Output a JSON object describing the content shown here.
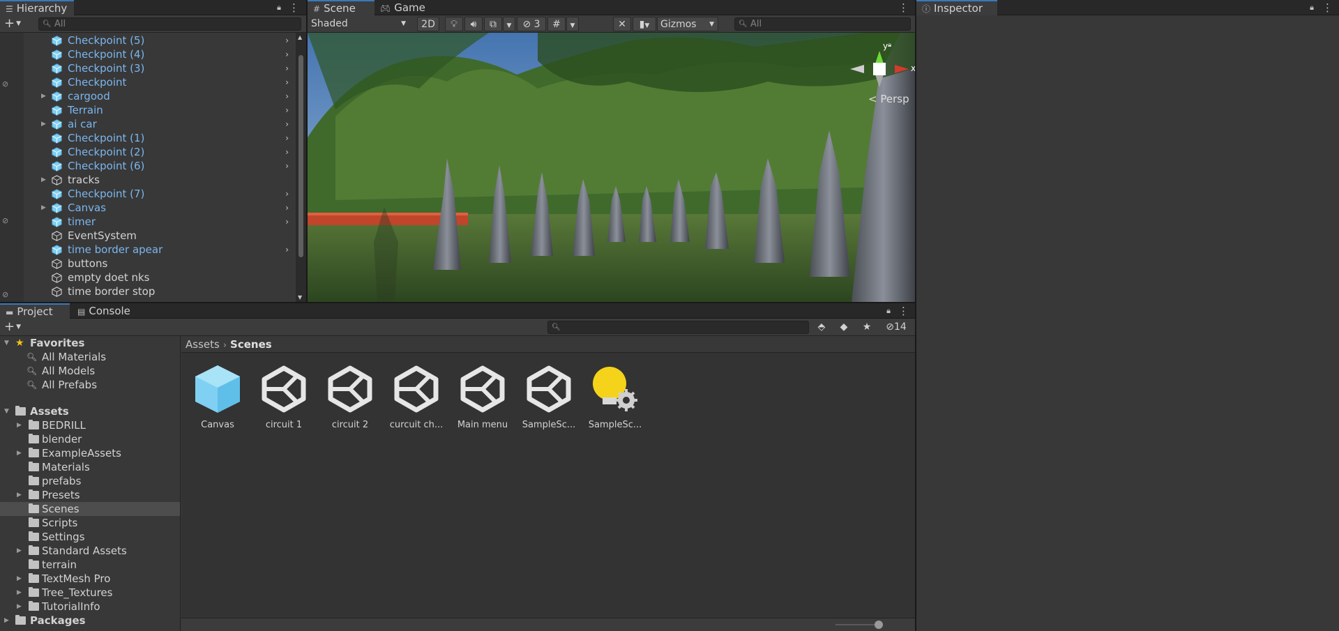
{
  "hierarchy": {
    "tab_label": "Hierarchy",
    "search_placeholder": "All",
    "items": [
      {
        "label": "Checkpoint (5)",
        "kind": "prefab",
        "expandable": false,
        "has_arrow": true
      },
      {
        "label": "Checkpoint (4)",
        "kind": "prefab",
        "expandable": false,
        "has_arrow": true
      },
      {
        "label": "Checkpoint (3)",
        "kind": "prefab",
        "expandable": false,
        "has_arrow": true
      },
      {
        "label": "Checkpoint",
        "kind": "prefab",
        "expandable": false,
        "has_arrow": true
      },
      {
        "label": "cargood",
        "kind": "prefab",
        "expandable": true,
        "has_arrow": true
      },
      {
        "label": "Terrain",
        "kind": "prefab",
        "expandable": false,
        "has_arrow": true
      },
      {
        "label": "ai car",
        "kind": "prefab",
        "expandable": true,
        "has_arrow": true
      },
      {
        "label": "Checkpoint (1)",
        "kind": "prefab",
        "expandable": false,
        "has_arrow": true
      },
      {
        "label": "Checkpoint (2)",
        "kind": "prefab",
        "expandable": false,
        "has_arrow": true
      },
      {
        "label": "Checkpoint (6)",
        "kind": "prefab",
        "expandable": false,
        "has_arrow": true
      },
      {
        "label": "tracks",
        "kind": "plain",
        "expandable": true,
        "has_arrow": false
      },
      {
        "label": "Checkpoint (7)",
        "kind": "prefab",
        "expandable": false,
        "has_arrow": true
      },
      {
        "label": "Canvas",
        "kind": "prefab",
        "expandable": true,
        "has_arrow": true
      },
      {
        "label": "timer",
        "kind": "prefab",
        "expandable": false,
        "has_arrow": true
      },
      {
        "label": "EventSystem",
        "kind": "plain",
        "expandable": false,
        "has_arrow": false
      },
      {
        "label": "time border apear",
        "kind": "prefab",
        "expandable": false,
        "has_arrow": true
      },
      {
        "label": "buttons",
        "kind": "plain",
        "expandable": false,
        "has_arrow": false
      },
      {
        "label": "empty doet nks",
        "kind": "plain",
        "expandable": false,
        "has_arrow": false
      },
      {
        "label": "time  border stop",
        "kind": "plain",
        "expandable": false,
        "has_arrow": false
      }
    ]
  },
  "scene": {
    "tabs": [
      {
        "label": "Scene",
        "icon": "grid-icon"
      },
      {
        "label": "Game",
        "icon": "gamepad-icon"
      }
    ],
    "shading_mode": "Shaded",
    "mode_2d_label": "2D",
    "hidden_count": "3",
    "gizmos_label": "Gizmos",
    "search_placeholder": "All",
    "gizmo": {
      "y_label": "y",
      "x_label": "x",
      "projection_label": "Persp"
    }
  },
  "project": {
    "tabs": [
      {
        "label": "Project",
        "icon": "folder-icon"
      },
      {
        "label": "Console",
        "icon": "console-icon"
      }
    ],
    "hidden_count": "14",
    "favorites": {
      "label": "Favorites",
      "items": [
        "All Materials",
        "All Models",
        "All Prefabs"
      ]
    },
    "assets_root": "Assets",
    "folders": [
      {
        "label": "BEDRILL",
        "expandable": true
      },
      {
        "label": "blender",
        "expandable": false
      },
      {
        "label": "ExampleAssets",
        "expandable": true
      },
      {
        "label": "Materials",
        "expandable": false
      },
      {
        "label": "prefabs",
        "expandable": false
      },
      {
        "label": "Presets",
        "expandable": true
      },
      {
        "label": "Scenes",
        "expandable": false,
        "selected": true
      },
      {
        "label": "Scripts",
        "expandable": false
      },
      {
        "label": "Settings",
        "expandable": false
      },
      {
        "label": "Standard Assets",
        "expandable": true
      },
      {
        "label": "terrain",
        "expandable": false
      },
      {
        "label": "TextMesh Pro",
        "expandable": true
      },
      {
        "label": "Tree_Textures",
        "expandable": true
      },
      {
        "label": "TutorialInfo",
        "expandable": true
      }
    ],
    "packages_label": "Packages",
    "breadcrumb": {
      "root": "Assets",
      "current": "Scenes"
    },
    "assets": [
      {
        "name": "Canvas",
        "icon": "prefab-cube-icon"
      },
      {
        "name": "circuit 1",
        "icon": "unity-scene-icon"
      },
      {
        "name": "circuit 2",
        "icon": "unity-scene-icon"
      },
      {
        "name": "curcuit ch...",
        "icon": "unity-scene-icon"
      },
      {
        "name": "Main menu",
        "icon": "unity-scene-icon"
      },
      {
        "name": "SampleSc...",
        "icon": "unity-scene-icon"
      },
      {
        "name": "SampleSc...",
        "icon": "lighting-settings-icon"
      }
    ]
  },
  "inspector": {
    "tab_label": "Inspector"
  },
  "colors": {
    "prefab_text": "#7bb6ef",
    "accent_tab": "#3a79bb",
    "panel_bg": "#383838",
    "lighting_yellow": "#f5d31a",
    "prefab_cube": "#7fd0f2"
  }
}
